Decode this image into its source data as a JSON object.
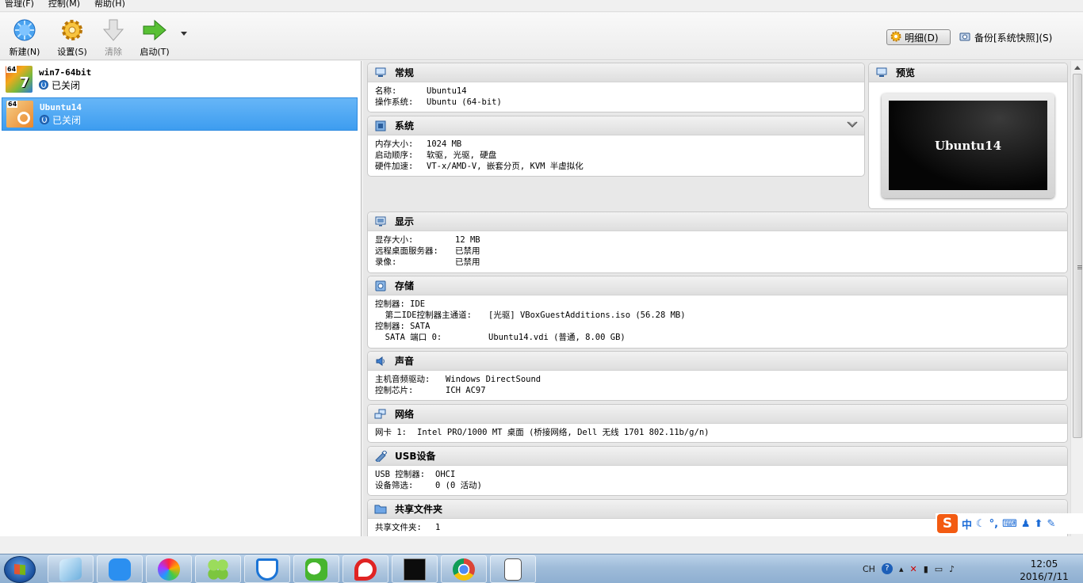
{
  "menu": [
    "管理(F)",
    "控制(M)",
    "帮助(H)"
  ],
  "toolbar": {
    "new": "新建(N)",
    "settings": "设置(S)",
    "discard": "清除",
    "start": "启动(T)",
    "detail_mode": "明细(D)",
    "snapshot_mode": "备份[系统快照](S)"
  },
  "vms": [
    {
      "name": "win7-64bit",
      "badge": "64",
      "os_glyph": "7",
      "state": "已关闭"
    },
    {
      "name": "Ubuntu14",
      "badge": "64",
      "os_glyph": "",
      "state": "已关闭"
    }
  ],
  "sections": {
    "general": {
      "title": "常规",
      "rows": [
        [
          "名称:",
          "Ubuntu14"
        ],
        [
          "操作系统:",
          "Ubuntu (64-bit)"
        ]
      ]
    },
    "system": {
      "title": "系统",
      "rows": [
        [
          "内存大小:",
          "1024 MB"
        ],
        [
          "启动顺序:",
          "软驱, 光驱, 硬盘"
        ],
        [
          "硬件加速:",
          "VT-x/AMD-V, 嵌套分页, KVM 半虚拟化"
        ]
      ]
    },
    "preview": {
      "title": "预览",
      "screen_text": "Ubuntu14"
    },
    "display": {
      "title": "显示",
      "rows": [
        [
          "显存大小:",
          "12 MB"
        ],
        [
          "远程桌面服务器:",
          "已禁用"
        ],
        [
          "录像:",
          "已禁用"
        ]
      ]
    },
    "storage": {
      "title": "存储",
      "rows": [
        [
          "控制器: IDE",
          ""
        ],
        [
          "  第二IDE控制器主通道:",
          "[光驱] VBoxGuestAdditions.iso (56.28 MB)"
        ],
        [
          "控制器: SATA",
          ""
        ],
        [
          "  SATA 端口 0:",
          "Ubuntu14.vdi (普通, 8.00 GB)"
        ]
      ]
    },
    "audio": {
      "title": "声音",
      "rows": [
        [
          "主机音频驱动:",
          "Windows DirectSound"
        ],
        [
          "控制芯片:",
          "ICH AC97"
        ]
      ]
    },
    "network": {
      "title": "网络",
      "rows": [
        [
          "网卡 1:",
          "Intel PRO/1000 MT 桌面 (桥接网络, Dell 无线 1701 802.11b/g/n)"
        ]
      ]
    },
    "usb": {
      "title": "USB设备",
      "rows": [
        [
          "USB 控制器:",
          "OHCI"
        ],
        [
          "设备筛选:",
          "0 (0 活动)"
        ]
      ]
    },
    "shared": {
      "title": "共享文件夹",
      "rows": [
        [
          "共享文件夹:",
          "1"
        ]
      ]
    }
  },
  "ime": {
    "logo": "S",
    "lang": "中"
  },
  "taskbar": {
    "lang": "CH",
    "time": "12:05",
    "date": "2016/7/11"
  }
}
